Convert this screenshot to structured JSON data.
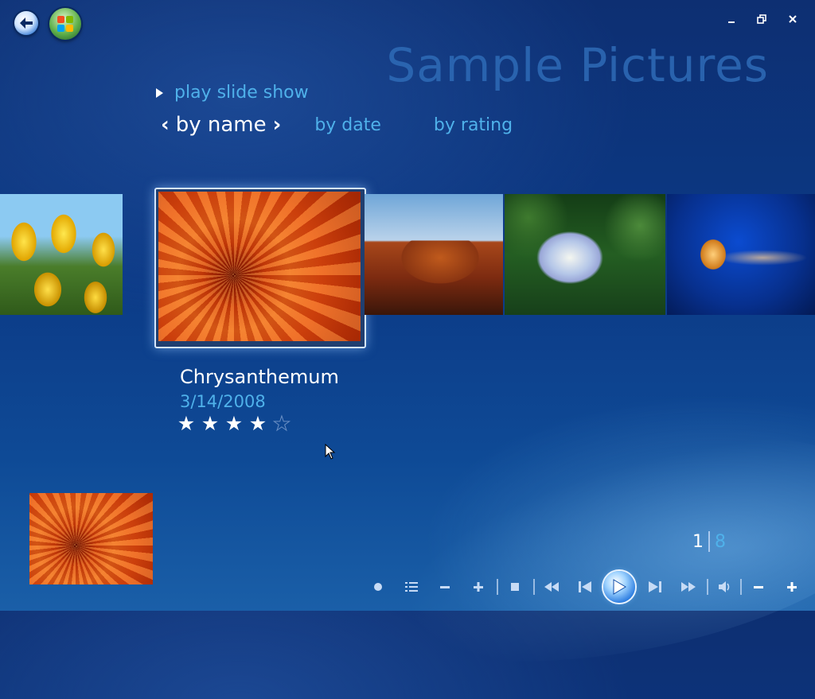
{
  "window": {
    "title": "Sample Pictures",
    "controls": {
      "minimize_icon": "minimize-icon",
      "restore_icon": "restore-icon",
      "close_icon": "close-icon"
    }
  },
  "nav": {
    "back_icon": "back-arrow-icon",
    "start_icon": "windows-start-icon"
  },
  "actions": {
    "slideshow_label": "play slide show"
  },
  "sort_tabs": [
    {
      "label": "by name",
      "active": true
    },
    {
      "label": "by date",
      "active": false
    },
    {
      "label": "by rating",
      "active": false
    }
  ],
  "gallery": {
    "items": [
      {
        "thumb": "tulips"
      },
      {
        "thumb": "chrysanthemum",
        "selected": true
      },
      {
        "thumb": "desert"
      },
      {
        "thumb": "hydrangeas"
      },
      {
        "thumb": "jellyfish"
      }
    ],
    "selected": {
      "name": "Chrysanthemum",
      "date": "3/14/2008",
      "rating": 4,
      "rating_max": 5
    }
  },
  "pager": {
    "current": "1",
    "total": "8"
  },
  "transport": {
    "buttons": [
      "record-icon",
      "list-icon",
      "minus-icon",
      "plus-icon",
      "stop-icon",
      "rewind-icon",
      "skip-back-icon",
      "play-icon",
      "skip-forward-icon",
      "fast-forward-icon",
      "volume-icon",
      "volume-down-icon",
      "volume-up-icon"
    ]
  },
  "colors": {
    "accent": "#4fb1ea",
    "background": "#0c3a86",
    "text": "#ffffff"
  }
}
